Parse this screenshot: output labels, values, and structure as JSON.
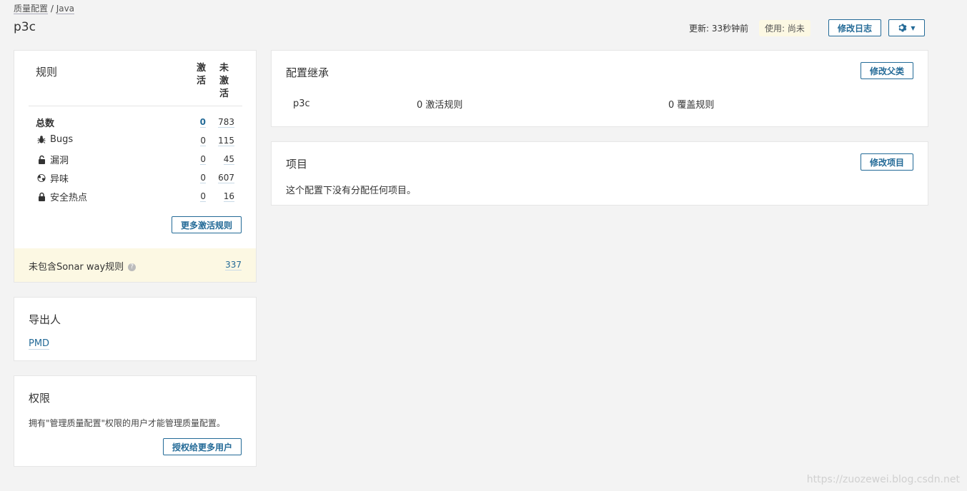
{
  "breadcrumb": {
    "root": "质量配置",
    "sep": " / ",
    "language": "Java"
  },
  "title": "p3c",
  "header": {
    "updated": "更新: 33秒钟前",
    "usage": "使用: 尚未",
    "changelog_label": "修改日志",
    "settings_icon": "gear-icon"
  },
  "rules": {
    "title": "规则",
    "col_active": "激\n活",
    "col_inactive": "未\n激\n活",
    "rows": [
      {
        "label": "总数",
        "active": "0",
        "inactive": "783"
      },
      {
        "label": "Bugs",
        "active": "0",
        "inactive": "115",
        "icon": "bug-icon"
      },
      {
        "label": "漏洞",
        "active": "0",
        "inactive": "45",
        "icon": "lock-icon"
      },
      {
        "label": "异味",
        "active": "0",
        "inactive": "607",
        "icon": "radiation-icon"
      },
      {
        "label": "安全热点",
        "active": "0",
        "inactive": "16",
        "icon": "lock-icon"
      }
    ],
    "activate_more_label": "更多激活规则",
    "sonar_way_label": "未包含Sonar way规则",
    "sonar_way_help": "?",
    "sonar_way_count": "337"
  },
  "exporters": {
    "title": "导出人",
    "items": [
      "PMD"
    ]
  },
  "permissions": {
    "title": "权限",
    "description": "拥有\"管理质量配置\"权限的用户才能管理质量配置。",
    "grant_label": "授权给更多用户"
  },
  "inheritance": {
    "title": "配置继承",
    "change_parent_label": "修改父类",
    "profile": "p3c",
    "active_rules": "0 激活规则",
    "overriding_rules": "0 覆盖规则"
  },
  "projects": {
    "title": "项目",
    "change_projects_label": "修改项目",
    "empty_message": "这个配置下没有分配任何项目。"
  },
  "watermark": "https://zuozewei.blog.csdn.net"
}
